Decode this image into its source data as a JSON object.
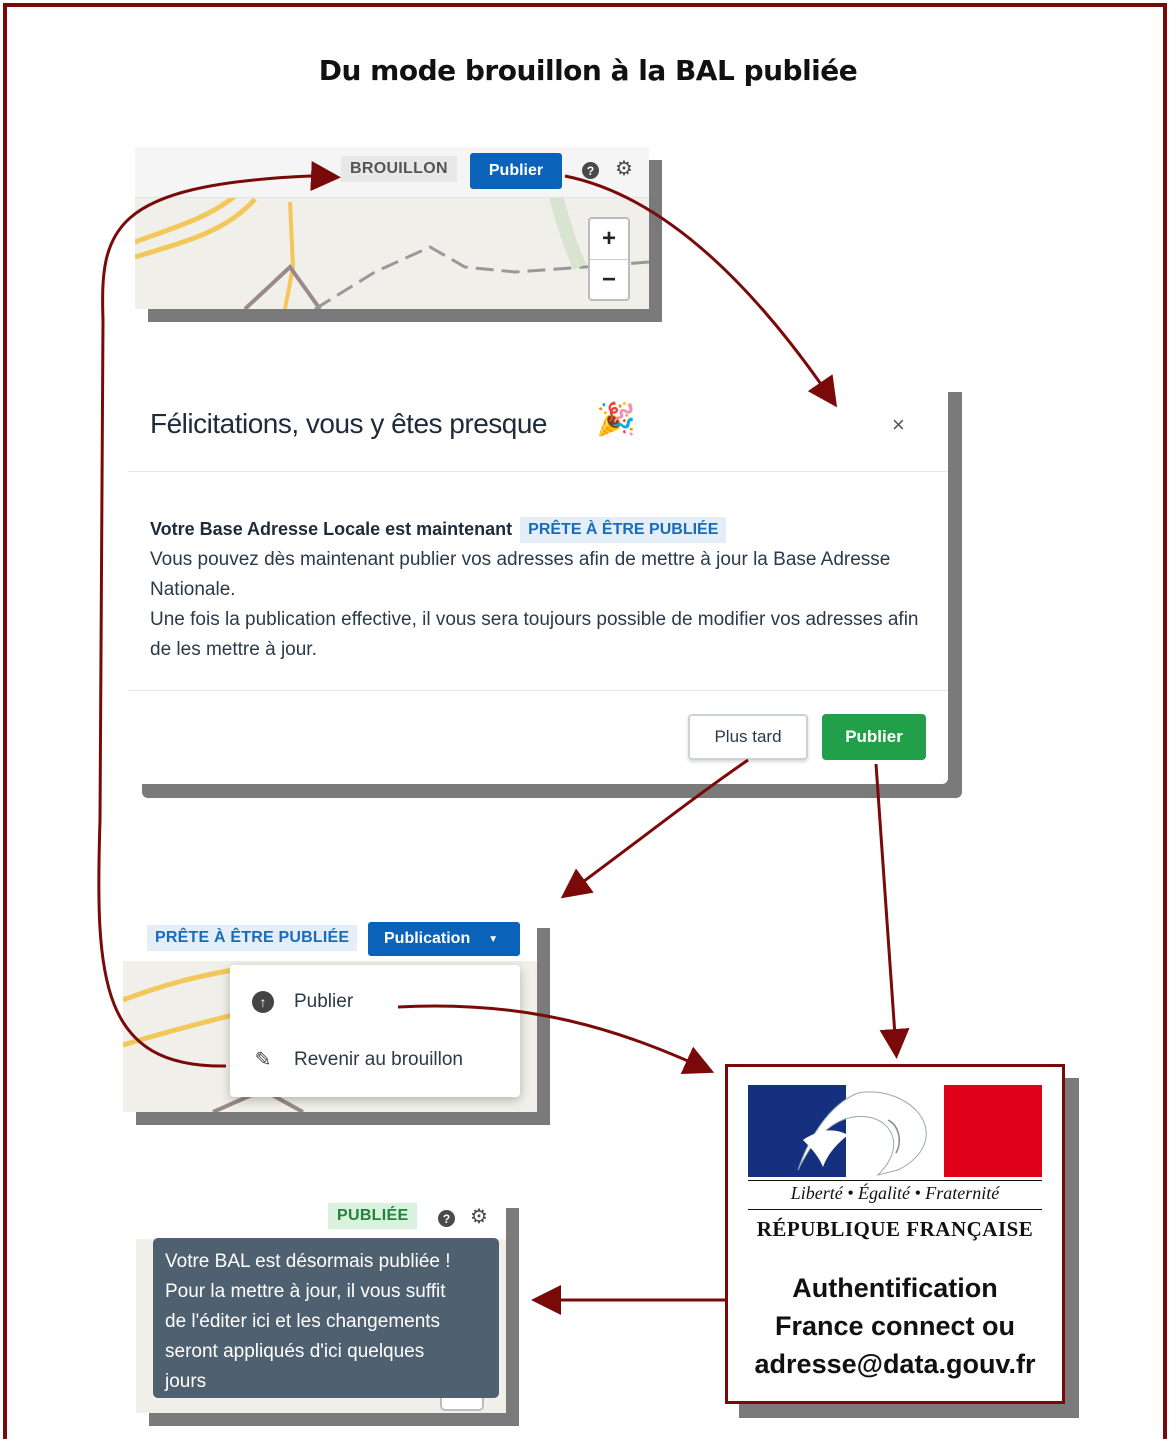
{
  "title": "Du mode brouillon à la BAL publiée",
  "panel_draft": {
    "status_badge": "BROUILLON",
    "publish_button": "Publier",
    "zoom_in": "+",
    "zoom_out": "−"
  },
  "modal": {
    "title": "Félicitations, vous y êtes presque",
    "close": "×",
    "lead": "Votre Base Adresse Locale est maintenant",
    "lead_badge": "PRÊTE À ÊTRE PUBLIÉE",
    "paragraph1": "Vous pouvez dès maintenant publier vos adresses afin de mettre à jour la Base Adresse Nationale.",
    "paragraph2": "Une fois la publication effective, il vous sera toujours possible de modifier vos adresses afin de les mettre à jour.",
    "later_button": "Plus tard",
    "publish_button": "Publier"
  },
  "panel_ready": {
    "status_badge": "PRÊTE À ÊTRE PUBLIÉE",
    "publication_button": "Publication",
    "menu": [
      {
        "label": "Publier",
        "icon": "arrow-up-circle-icon"
      },
      {
        "label": "Revenir au brouillon",
        "icon": "pencil-icon"
      }
    ]
  },
  "panel_published": {
    "status_badge": "PUBLIÉE",
    "tooltip_lines": [
      "Votre BAL est désormais publiée !",
      "Pour la mettre à jour, il vous suffit",
      "de l'éditer ici et les changements",
      "seront appliqués d'ici quelques",
      "jours"
    ]
  },
  "republique": {
    "motto": "Liberté • Égalité • Fraternité",
    "name": "RÉPUBLIQUE FRANÇAISE",
    "auth_lines": [
      "Authentification",
      "France connect ou",
      "adresse@data.gouv.fr"
    ]
  },
  "colors": {
    "frame": "#7a0a0a",
    "arrow": "#7a0a0a",
    "primary_blue": "#0b63b9",
    "success_green": "#21a049",
    "flag_blue": "#14307e",
    "flag_red": "#e1001a"
  }
}
